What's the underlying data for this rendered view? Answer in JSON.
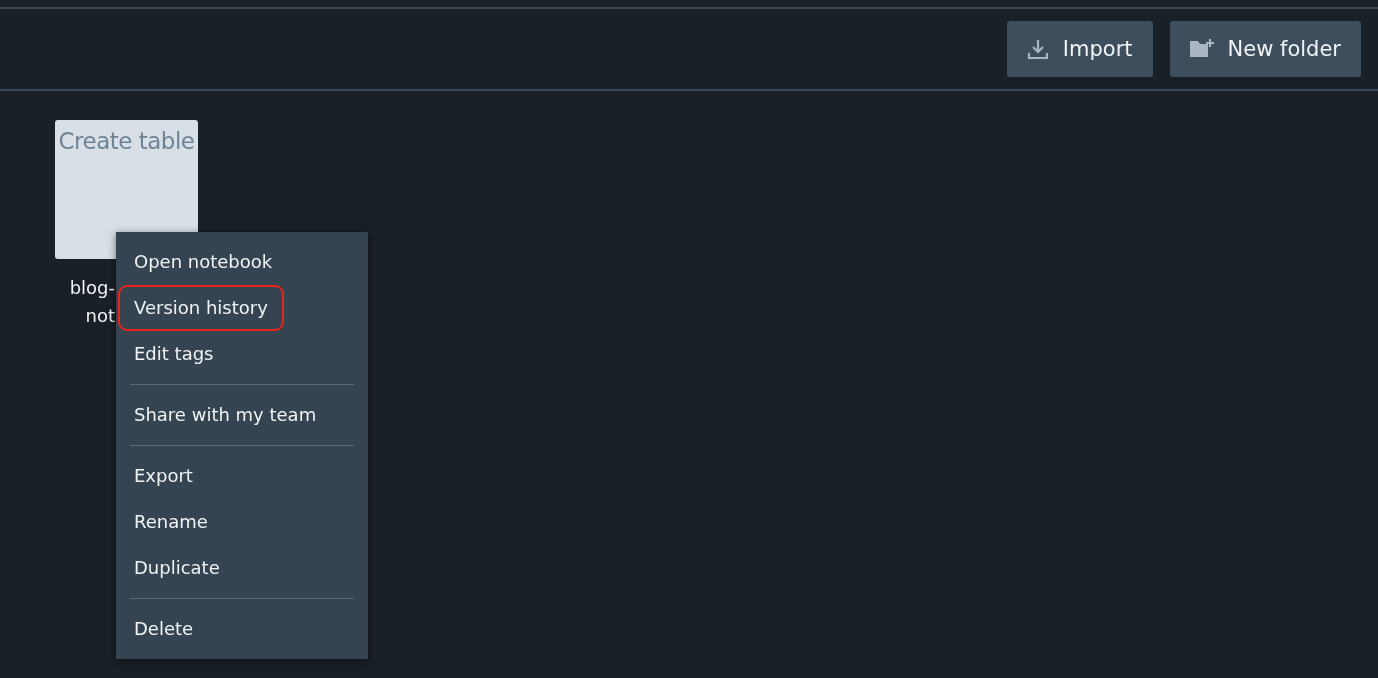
{
  "toolbar": {
    "buttons": [
      {
        "kind": "import",
        "label": "Import"
      },
      {
        "kind": "new-folder",
        "label": "New folder"
      }
    ]
  },
  "notebooks": [
    {
      "thumbnail_text": "Create table",
      "name_lines": [
        "blog-",
        "not"
      ]
    }
  ],
  "context_menu": {
    "groups": [
      {
        "items": [
          {
            "label": "Open notebook",
            "highlighted": false
          },
          {
            "label": "Version history",
            "highlighted": true
          },
          {
            "label": "Edit tags",
            "highlighted": false
          }
        ]
      },
      {
        "items": [
          {
            "label": "Share with my team",
            "highlighted": false
          }
        ]
      },
      {
        "items": [
          {
            "label": "Export",
            "highlighted": false
          },
          {
            "label": "Rename",
            "highlighted": false
          },
          {
            "label": "Duplicate",
            "highlighted": false
          }
        ]
      },
      {
        "items": [
          {
            "label": "Delete",
            "highlighted": false
          }
        ]
      }
    ]
  }
}
